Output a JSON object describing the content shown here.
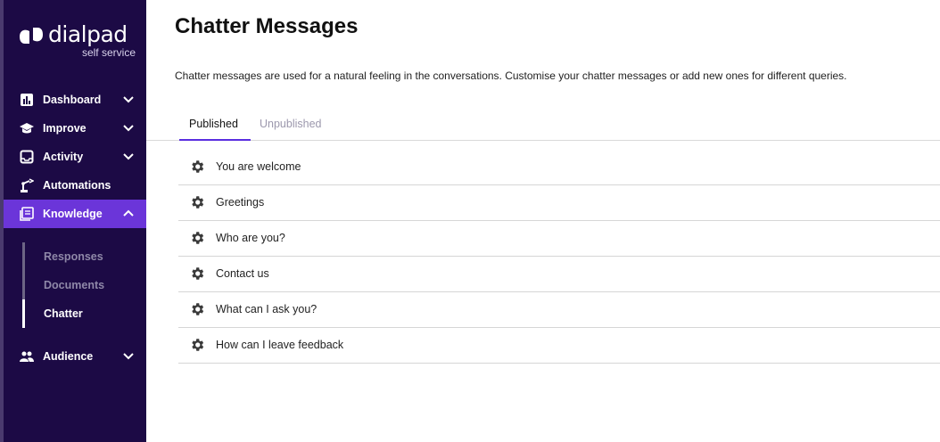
{
  "brand": {
    "name": "dialpad",
    "subtitle": "self service"
  },
  "sidebar": {
    "items": [
      {
        "label": "Dashboard",
        "icon": "bar-chart-icon",
        "has_chevron": true,
        "expanded": false
      },
      {
        "label": "Improve",
        "icon": "graduation-cap-icon",
        "has_chevron": true,
        "expanded": false
      },
      {
        "label": "Activity",
        "icon": "inbox-icon",
        "has_chevron": true,
        "expanded": false
      },
      {
        "label": "Automations",
        "icon": "robot-arm-icon",
        "has_chevron": false
      },
      {
        "label": "Knowledge",
        "icon": "book-icon",
        "has_chevron": true,
        "expanded": true,
        "active": true
      },
      {
        "label": "Audience",
        "icon": "people-icon",
        "has_chevron": true,
        "expanded": false
      }
    ],
    "knowledge_sub": [
      {
        "label": "Responses",
        "active": false
      },
      {
        "label": "Documents",
        "active": false
      },
      {
        "label": "Chatter",
        "active": true
      }
    ]
  },
  "main": {
    "title": "Chatter Messages",
    "description": "Chatter messages are used for a natural feeling in the conversations. Customise your chatter messages or add new ones for different queries.",
    "tabs": [
      {
        "label": "Published",
        "active": true
      },
      {
        "label": "Unpublished",
        "active": false
      }
    ],
    "messages": [
      {
        "label": "You are welcome",
        "icon": "gear-icon"
      },
      {
        "label": "Greetings",
        "icon": "gear-icon"
      },
      {
        "label": "Who are you?",
        "icon": "gear-icon"
      },
      {
        "label": "Contact us",
        "icon": "gear-icon"
      },
      {
        "label": "What can I ask you?",
        "icon": "gear-icon"
      },
      {
        "label": "How can I leave feedback",
        "icon": "gear-icon"
      }
    ]
  },
  "colors": {
    "sidebar_bg": "#1c0a45",
    "active_nav": "#6b35d9",
    "tab_underline": "#5a2ee0"
  }
}
